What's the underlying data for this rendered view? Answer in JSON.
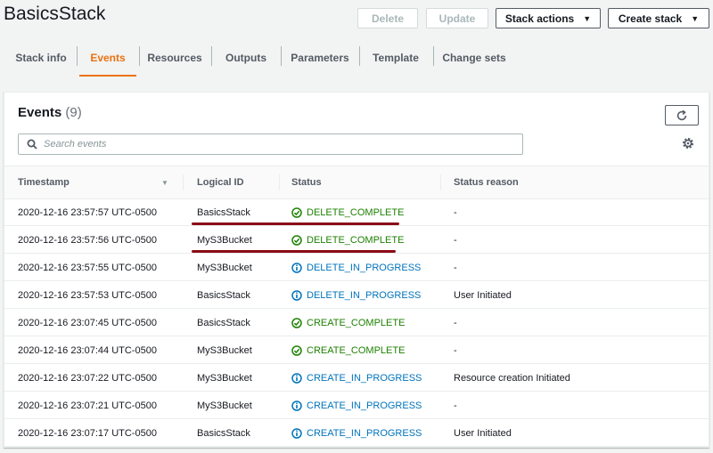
{
  "header": {
    "title": "BasicsStack",
    "delete_label": "Delete",
    "update_label": "Update",
    "stack_actions_label": "Stack actions",
    "create_stack_label": "Create stack"
  },
  "tabs": [
    {
      "label": "Stack info",
      "active": false
    },
    {
      "label": "Events",
      "active": true
    },
    {
      "label": "Resources",
      "active": false
    },
    {
      "label": "Outputs",
      "active": false
    },
    {
      "label": "Parameters",
      "active": false
    },
    {
      "label": "Template",
      "active": false
    },
    {
      "label": "Change sets",
      "active": false
    }
  ],
  "events": {
    "title": "Events",
    "count": "(9)",
    "search_placeholder": "Search events",
    "columns": [
      "Timestamp",
      "Logical ID",
      "Status",
      "Status reason"
    ],
    "rows": [
      {
        "timestamp": "2020-12-16 23:57:57 UTC-0500",
        "logical_id": "BasicsStack",
        "status": "DELETE_COMPLETE",
        "kind": "complete",
        "reason": "-"
      },
      {
        "timestamp": "2020-12-16 23:57:56 UTC-0500",
        "logical_id": "MyS3Bucket",
        "status": "DELETE_COMPLETE",
        "kind": "complete",
        "reason": "-"
      },
      {
        "timestamp": "2020-12-16 23:57:55 UTC-0500",
        "logical_id": "MyS3Bucket",
        "status": "DELETE_IN_PROGRESS",
        "kind": "progress",
        "reason": "-"
      },
      {
        "timestamp": "2020-12-16 23:57:53 UTC-0500",
        "logical_id": "BasicsStack",
        "status": "DELETE_IN_PROGRESS",
        "kind": "progress",
        "reason": "User Initiated"
      },
      {
        "timestamp": "2020-12-16 23:07:45 UTC-0500",
        "logical_id": "BasicsStack",
        "status": "CREATE_COMPLETE",
        "kind": "complete",
        "reason": "-"
      },
      {
        "timestamp": "2020-12-16 23:07:44 UTC-0500",
        "logical_id": "MyS3Bucket",
        "status": "CREATE_COMPLETE",
        "kind": "complete",
        "reason": "-"
      },
      {
        "timestamp": "2020-12-16 23:07:22 UTC-0500",
        "logical_id": "MyS3Bucket",
        "status": "CREATE_IN_PROGRESS",
        "kind": "progress",
        "reason": "Resource creation Initiated"
      },
      {
        "timestamp": "2020-12-16 23:07:21 UTC-0500",
        "logical_id": "MyS3Bucket",
        "status": "CREATE_IN_PROGRESS",
        "kind": "progress",
        "reason": "-"
      },
      {
        "timestamp": "2020-12-16 23:07:17 UTC-0500",
        "logical_id": "BasicsStack",
        "status": "CREATE_IN_PROGRESS",
        "kind": "progress",
        "reason": "User Initiated"
      }
    ]
  },
  "colors": {
    "accent": "#ec7211",
    "success": "#1d8102",
    "info": "#0073bb",
    "annotation": "#8b0b16"
  },
  "icons": {
    "complete": "check-circle-icon",
    "progress": "info-circle-icon",
    "refresh": "refresh-icon",
    "search": "search-icon",
    "settings": "gear-icon"
  }
}
